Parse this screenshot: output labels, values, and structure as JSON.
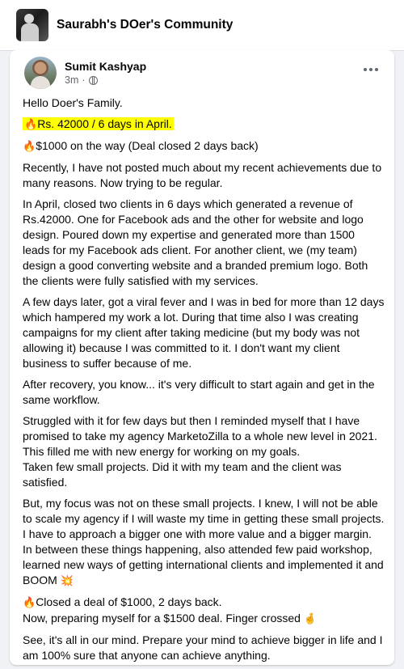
{
  "group": {
    "name": "Saurabh's DOer's Community"
  },
  "post": {
    "author": "Sumit Kashyap",
    "time": "3m",
    "separator": "·",
    "greeting": "Hello Doer's Family.",
    "highlight": "Rs. 42000 / 6 days in April.",
    "line2": "$1000 on the way (Deal closed 2 days back)",
    "p1": "Recently, I have not posted much about my recent achievements due to many reasons. Now trying to be regular.",
    "p2": "In April, closed two clients in 6 days which generated a revenue of Rs.42000. One for Facebook ads and the other for website and logo design. Poured down my expertise and generated more than 1500 leads for my Facebook ads client. For another client, we (my team) design a good converting website and a branded premium logo. Both the clients were fully satisfied with my services.",
    "p3": "A few days later, got a viral fever and I was in bed for more than 12 days which hampered my work a lot. During that time also I was creating campaigns for my client after taking medicine (but my body was not allowing it) because I was committed to it. I don't want my client business to suffer because of me.",
    "p4": "After recovery, you know... it's very difficult to start again and get in the same workflow.",
    "p5": "Struggled with it for few days but then I reminded myself that I have promised to take my agency MarketoZilla to a whole new level in 2021. This filled me with new energy for working on my goals.\nTaken few small projects. Did it with my team and the client was satisfied.",
    "p6": "But, my focus was not on these small projects. I knew, I will not be able to scale my agency if I will waste my time in getting these small projects. I have to approach a bigger one with more value and a bigger margin.\nIn between these things happening, also attended few paid workshop, learned new ways of getting international clients and implemented it and BOOM",
    "p7a": "Closed a deal of $1000, 2 days back.",
    "p7b": "Now, preparing myself for a $1500 deal. Finger crossed",
    "p8": "See, it's all in our mind. Prepare your mind to achieve bigger in life and I am 100% sure that anyone can achieve anything."
  },
  "icons": {
    "fire": "🔥",
    "boom": "💥",
    "fingers": "🤞",
    "privacy": "globe-icon",
    "menu": "more-icon"
  },
  "colors": {
    "highlight": "#ffff00",
    "background": "#f0f2f5",
    "meta": "#65676b"
  }
}
